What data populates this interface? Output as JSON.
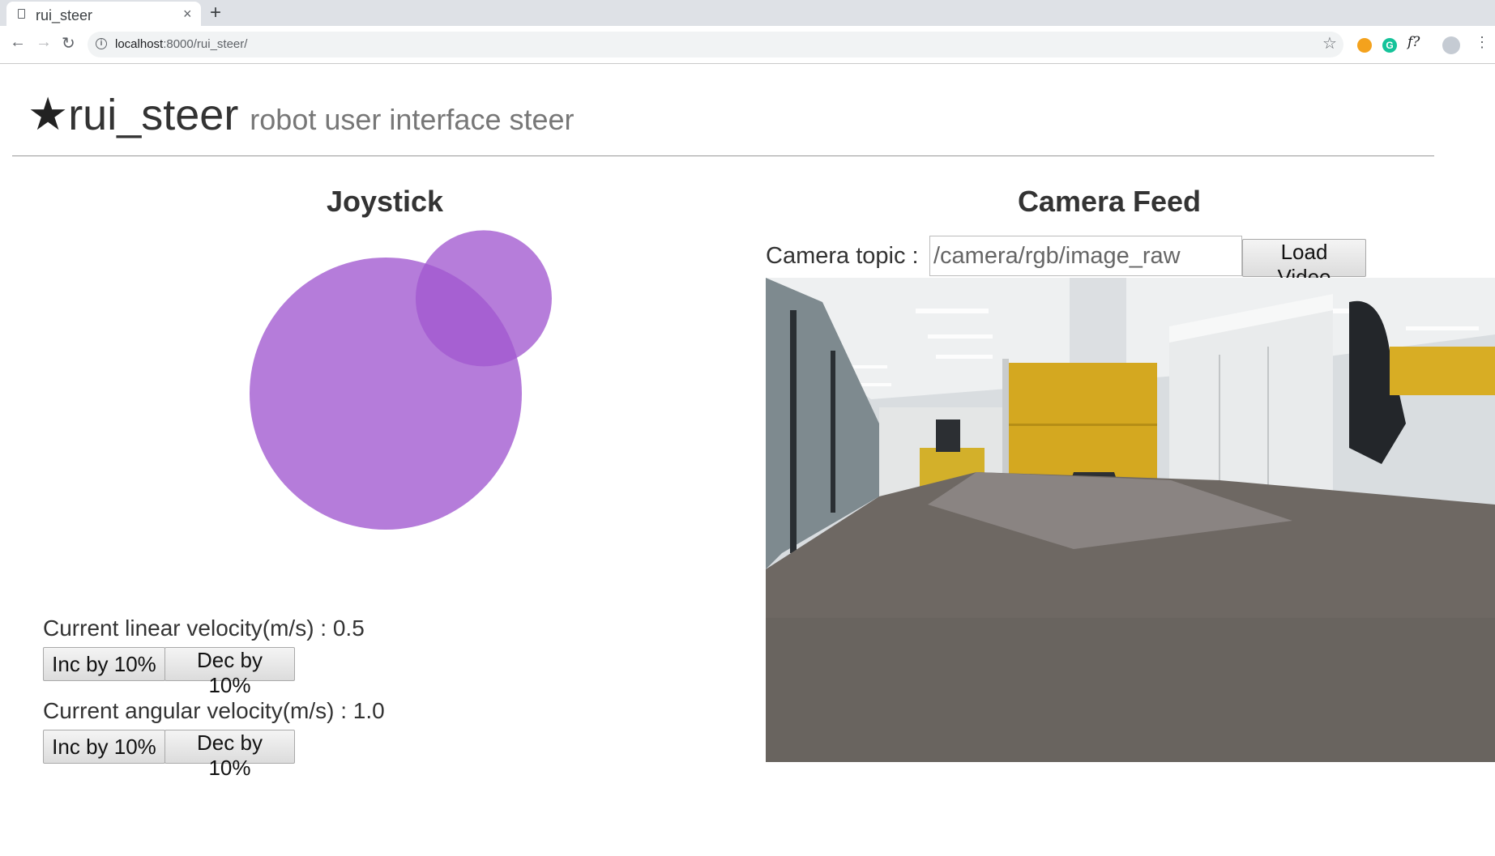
{
  "browser": {
    "tab_title": "rui_steer",
    "tab_close": "×",
    "new_tab": "+",
    "url_host": "localhost",
    "url_path": ":8000/rui_steer/",
    "back_icon": "←",
    "forward_icon": "→",
    "reload_icon": "↻",
    "bookmark_icon": "☆",
    "menu_icon": "⋮",
    "ext_grammarly": "G",
    "ext_formula": "f?"
  },
  "header": {
    "logo_glyph": "★",
    "title": "rui_steer",
    "subtitle": "robot user interface steer"
  },
  "joystick": {
    "heading": "Joystick",
    "base_color": "#b57cda",
    "knob_color": "#a259d0",
    "knob_offset": {
      "x": 0.72,
      "y": -0.7
    }
  },
  "velocity": {
    "linear_label": "Current linear velocity(m/s) : 0.5",
    "angular_label": "Current angular velocity(m/s) : 1.0",
    "inc_label": "Inc by 10%",
    "dec_label": "Dec by 10%"
  },
  "camera": {
    "heading": "Camera Feed",
    "topic_label": "Camera topic :",
    "topic_value": "/camera/rgb/image_raw",
    "load_button": "Load Video"
  }
}
